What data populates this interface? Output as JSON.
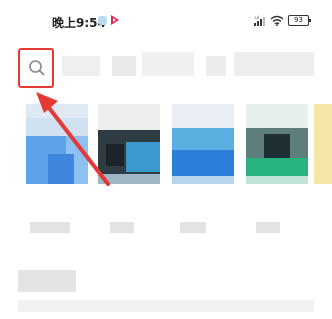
{
  "status_bar": {
    "time": "晚上9:54",
    "battery": "93",
    "icons": [
      "cloud-notification-icon",
      "video-app-notification-icon",
      "cellular-signal-icon",
      "wifi-icon",
      "battery-icon"
    ]
  },
  "search": {
    "icon": "search-icon",
    "highlight_color": "#e53935"
  },
  "annotation": {
    "arrow_color": "#e53935"
  }
}
